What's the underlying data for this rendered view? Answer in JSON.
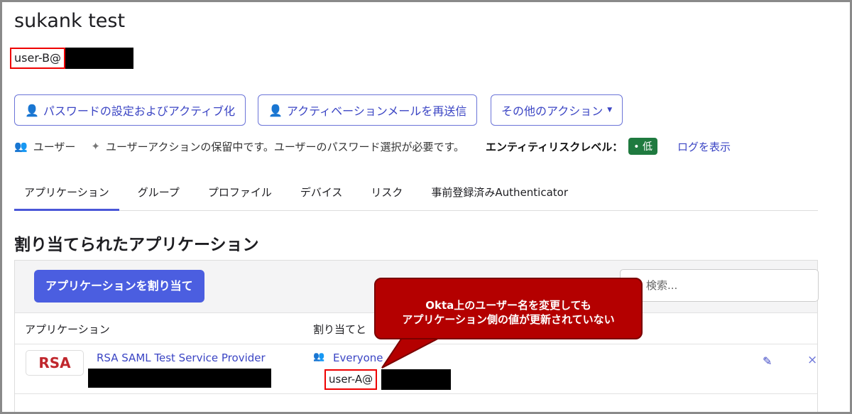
{
  "user": {
    "name": "sukank test",
    "email_prefix": "user-B@"
  },
  "actions": {
    "set_password": "パスワードの設定およびアクティブ化",
    "resend": "アクティベーションメールを再送信",
    "more": "その他のアクション"
  },
  "status": {
    "type": "ユーザー",
    "pending": "ユーザーアクションの保留中です。ユーザーのパスワード選択が必要です。",
    "risk_label": "エンティティリスクレベル：",
    "risk_value": "• 低",
    "view_logs": "ログを表示"
  },
  "tabs": [
    "アプリケーション",
    "グループ",
    "プロファイル",
    "デバイス",
    "リスク",
    "事前登録済みAuthenticator"
  ],
  "section_title": "割り当てられたアプリケーション",
  "assign_button": "アプリケーションを割り当て",
  "search_placeholder": "検索...",
  "table": {
    "headers": [
      "アプリケーション",
      "割り当てと"
    ],
    "rows": [
      {
        "logo": "RSA",
        "app": "RSA SAML Test Service Provider",
        "assigned": "Everyone",
        "username_prefix": "user-A@"
      }
    ]
  },
  "callout": {
    "line1": "Okta上のユーザー名を変更しても",
    "line2": "アプリケーション側の値が更新されていない"
  },
  "colors": {
    "accent": "#4b5ee0",
    "risk_low": "#1f7a3f",
    "callout": "#b40000"
  }
}
